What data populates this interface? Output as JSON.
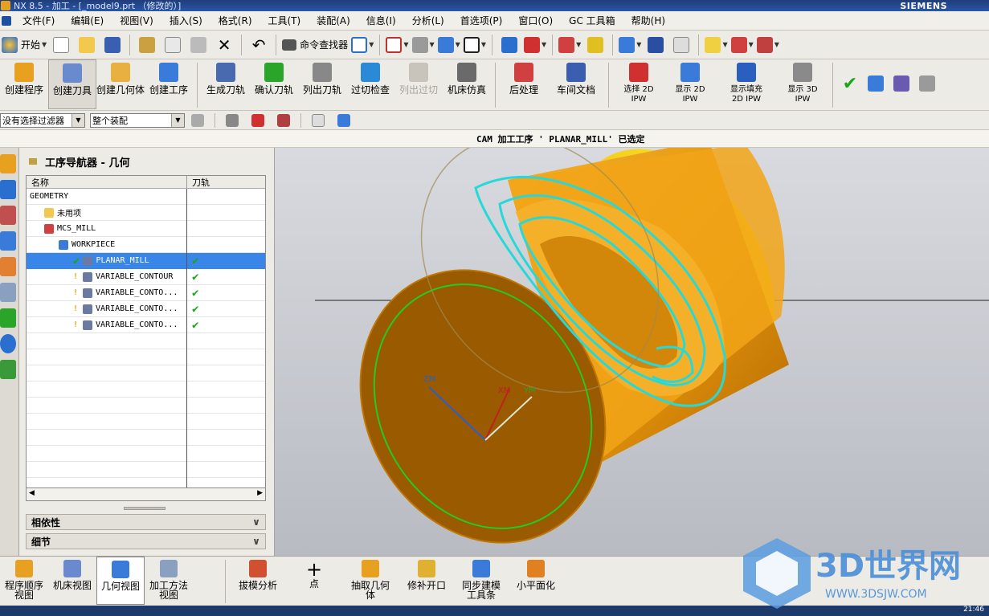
{
  "window": {
    "title": "NX 8.5 - 加工 - [_model9.prt （修改的）]",
    "brand": "SIEMENS"
  },
  "menu": [
    "文件(F)",
    "编辑(E)",
    "视图(V)",
    "插入(S)",
    "格式(R)",
    "工具(T)",
    "装配(A)",
    "信息(I)",
    "分析(L)",
    "首选项(P)",
    "窗口(O)",
    "GC 工具箱",
    "帮助(H)"
  ],
  "toolbar1": {
    "start_label": "开始",
    "command_finder_label": "命令查找器"
  },
  "toolbar2": {
    "buttons": [
      "创建程序",
      "创建刀具",
      "创建几何体",
      "创建工序",
      "生成刀轨",
      "确认刀轨",
      "列出刀轨",
      "过切检查",
      "列出过切",
      "机床仿真",
      "后处理",
      "车间文档"
    ],
    "ipw_buttons": [
      [
        "选择 2D",
        "IPW"
      ],
      [
        "显示 2D",
        "IPW"
      ],
      [
        "显示填充",
        "2D IPW"
      ],
      [
        "显示 3D",
        "IPW"
      ]
    ]
  },
  "filterbar": {
    "filter_value": "没有选择过滤器",
    "assembly_value": "整个装配"
  },
  "status": {
    "message": "CAM 加工工序 ' PLANAR_MILL' 已选定"
  },
  "navigator": {
    "title": "工序导航器 - 几何",
    "columns": [
      "名称",
      "刀轨"
    ],
    "rows": [
      {
        "name": "GEOMETRY",
        "indent": 0,
        "icon": "",
        "check": "",
        "path": ""
      },
      {
        "name": "未用项",
        "indent": 1,
        "icon": "folder-icon",
        "check": "",
        "path": ""
      },
      {
        "name": "MCS_MILL",
        "indent": 1,
        "icon": "mcs-icon",
        "check": "",
        "path": ""
      },
      {
        "name": "WORKPIECE",
        "indent": 2,
        "icon": "workpiece-icon",
        "check": "",
        "path": ""
      },
      {
        "name": "PLANAR_MILL",
        "indent": 3,
        "icon": "operation-icon",
        "check": "✔",
        "path": "✔",
        "selected": true
      },
      {
        "name": "VARIABLE_CONTOUR",
        "indent": 3,
        "icon": "operation-icon",
        "check": "warn",
        "path": "✔"
      },
      {
        "name": "VARIABLE_CONTO...",
        "indent": 3,
        "icon": "operation-icon",
        "check": "warn",
        "path": "✔"
      },
      {
        "name": "VARIABLE_CONTO...",
        "indent": 3,
        "icon": "operation-icon",
        "check": "warn",
        "path": "✔"
      },
      {
        "name": "VARIABLE_CONTO...",
        "indent": 3,
        "icon": "operation-icon",
        "check": "warn",
        "path": "✔"
      }
    ],
    "dependencies_label": "相依性",
    "details_label": "细节"
  },
  "viewport": {
    "axes": [
      "ZM",
      "XM",
      "YM"
    ]
  },
  "bottombar": {
    "views": [
      [
        "程序顺序",
        "视图"
      ],
      [
        "机床视图",
        ""
      ],
      [
        "几何视图",
        ""
      ],
      [
        "加工方法",
        "视图"
      ]
    ],
    "tools": [
      [
        "拔模分析",
        ""
      ],
      [
        "点",
        ""
      ],
      [
        "抽取几何",
        "体"
      ],
      [
        "修补开口",
        ""
      ],
      [
        "同步建模",
        "工具条"
      ],
      [
        "小平面化",
        ""
      ]
    ]
  },
  "watermark": {
    "title": "3D世界网",
    "url": "WWW.3DSJW.COM"
  },
  "clock": "21:46",
  "colors": {
    "part": "#e8960a",
    "toolpath": "#27d8d8",
    "selection": "#3a86e8"
  }
}
